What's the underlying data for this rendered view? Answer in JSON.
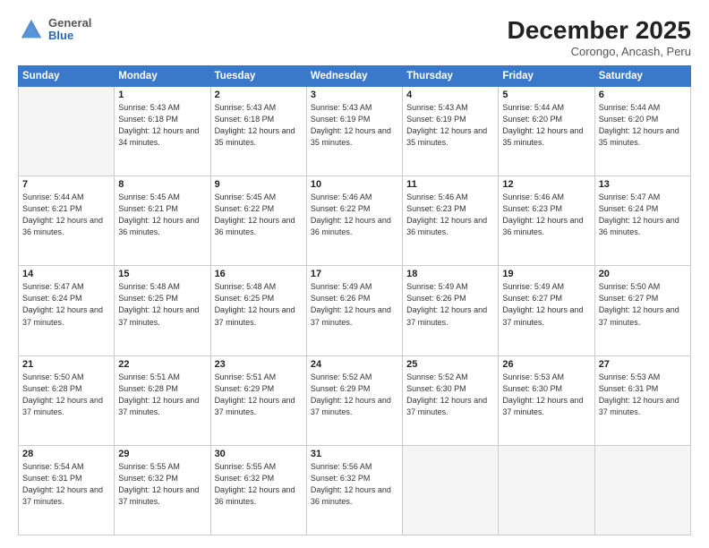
{
  "header": {
    "logo_general": "General",
    "logo_blue": "Blue",
    "title": "December 2025",
    "subtitle": "Corongo, Ancash, Peru"
  },
  "columns": [
    "Sunday",
    "Monday",
    "Tuesday",
    "Wednesday",
    "Thursday",
    "Friday",
    "Saturday"
  ],
  "weeks": [
    [
      {
        "day": "",
        "empty": true
      },
      {
        "day": "1",
        "sunrise": "Sunrise: 5:43 AM",
        "sunset": "Sunset: 6:18 PM",
        "daylight": "Daylight: 12 hours and 34 minutes."
      },
      {
        "day": "2",
        "sunrise": "Sunrise: 5:43 AM",
        "sunset": "Sunset: 6:18 PM",
        "daylight": "Daylight: 12 hours and 35 minutes."
      },
      {
        "day": "3",
        "sunrise": "Sunrise: 5:43 AM",
        "sunset": "Sunset: 6:19 PM",
        "daylight": "Daylight: 12 hours and 35 minutes."
      },
      {
        "day": "4",
        "sunrise": "Sunrise: 5:43 AM",
        "sunset": "Sunset: 6:19 PM",
        "daylight": "Daylight: 12 hours and 35 minutes."
      },
      {
        "day": "5",
        "sunrise": "Sunrise: 5:44 AM",
        "sunset": "Sunset: 6:20 PM",
        "daylight": "Daylight: 12 hours and 35 minutes."
      },
      {
        "day": "6",
        "sunrise": "Sunrise: 5:44 AM",
        "sunset": "Sunset: 6:20 PM",
        "daylight": "Daylight: 12 hours and 35 minutes."
      }
    ],
    [
      {
        "day": "7",
        "sunrise": "Sunrise: 5:44 AM",
        "sunset": "Sunset: 6:21 PM",
        "daylight": "Daylight: 12 hours and 36 minutes."
      },
      {
        "day": "8",
        "sunrise": "Sunrise: 5:45 AM",
        "sunset": "Sunset: 6:21 PM",
        "daylight": "Daylight: 12 hours and 36 minutes."
      },
      {
        "day": "9",
        "sunrise": "Sunrise: 5:45 AM",
        "sunset": "Sunset: 6:22 PM",
        "daylight": "Daylight: 12 hours and 36 minutes."
      },
      {
        "day": "10",
        "sunrise": "Sunrise: 5:46 AM",
        "sunset": "Sunset: 6:22 PM",
        "daylight": "Daylight: 12 hours and 36 minutes."
      },
      {
        "day": "11",
        "sunrise": "Sunrise: 5:46 AM",
        "sunset": "Sunset: 6:23 PM",
        "daylight": "Daylight: 12 hours and 36 minutes."
      },
      {
        "day": "12",
        "sunrise": "Sunrise: 5:46 AM",
        "sunset": "Sunset: 6:23 PM",
        "daylight": "Daylight: 12 hours and 36 minutes."
      },
      {
        "day": "13",
        "sunrise": "Sunrise: 5:47 AM",
        "sunset": "Sunset: 6:24 PM",
        "daylight": "Daylight: 12 hours and 36 minutes."
      }
    ],
    [
      {
        "day": "14",
        "sunrise": "Sunrise: 5:47 AM",
        "sunset": "Sunset: 6:24 PM",
        "daylight": "Daylight: 12 hours and 37 minutes."
      },
      {
        "day": "15",
        "sunrise": "Sunrise: 5:48 AM",
        "sunset": "Sunset: 6:25 PM",
        "daylight": "Daylight: 12 hours and 37 minutes."
      },
      {
        "day": "16",
        "sunrise": "Sunrise: 5:48 AM",
        "sunset": "Sunset: 6:25 PM",
        "daylight": "Daylight: 12 hours and 37 minutes."
      },
      {
        "day": "17",
        "sunrise": "Sunrise: 5:49 AM",
        "sunset": "Sunset: 6:26 PM",
        "daylight": "Daylight: 12 hours and 37 minutes."
      },
      {
        "day": "18",
        "sunrise": "Sunrise: 5:49 AM",
        "sunset": "Sunset: 6:26 PM",
        "daylight": "Daylight: 12 hours and 37 minutes."
      },
      {
        "day": "19",
        "sunrise": "Sunrise: 5:49 AM",
        "sunset": "Sunset: 6:27 PM",
        "daylight": "Daylight: 12 hours and 37 minutes."
      },
      {
        "day": "20",
        "sunrise": "Sunrise: 5:50 AM",
        "sunset": "Sunset: 6:27 PM",
        "daylight": "Daylight: 12 hours and 37 minutes."
      }
    ],
    [
      {
        "day": "21",
        "sunrise": "Sunrise: 5:50 AM",
        "sunset": "Sunset: 6:28 PM",
        "daylight": "Daylight: 12 hours and 37 minutes."
      },
      {
        "day": "22",
        "sunrise": "Sunrise: 5:51 AM",
        "sunset": "Sunset: 6:28 PM",
        "daylight": "Daylight: 12 hours and 37 minutes."
      },
      {
        "day": "23",
        "sunrise": "Sunrise: 5:51 AM",
        "sunset": "Sunset: 6:29 PM",
        "daylight": "Daylight: 12 hours and 37 minutes."
      },
      {
        "day": "24",
        "sunrise": "Sunrise: 5:52 AM",
        "sunset": "Sunset: 6:29 PM",
        "daylight": "Daylight: 12 hours and 37 minutes."
      },
      {
        "day": "25",
        "sunrise": "Sunrise: 5:52 AM",
        "sunset": "Sunset: 6:30 PM",
        "daylight": "Daylight: 12 hours and 37 minutes."
      },
      {
        "day": "26",
        "sunrise": "Sunrise: 5:53 AM",
        "sunset": "Sunset: 6:30 PM",
        "daylight": "Daylight: 12 hours and 37 minutes."
      },
      {
        "day": "27",
        "sunrise": "Sunrise: 5:53 AM",
        "sunset": "Sunset: 6:31 PM",
        "daylight": "Daylight: 12 hours and 37 minutes."
      }
    ],
    [
      {
        "day": "28",
        "sunrise": "Sunrise: 5:54 AM",
        "sunset": "Sunset: 6:31 PM",
        "daylight": "Daylight: 12 hours and 37 minutes."
      },
      {
        "day": "29",
        "sunrise": "Sunrise: 5:55 AM",
        "sunset": "Sunset: 6:32 PM",
        "daylight": "Daylight: 12 hours and 37 minutes."
      },
      {
        "day": "30",
        "sunrise": "Sunrise: 5:55 AM",
        "sunset": "Sunset: 6:32 PM",
        "daylight": "Daylight: 12 hours and 36 minutes."
      },
      {
        "day": "31",
        "sunrise": "Sunrise: 5:56 AM",
        "sunset": "Sunset: 6:32 PM",
        "daylight": "Daylight: 12 hours and 36 minutes."
      },
      {
        "day": "",
        "empty": true
      },
      {
        "day": "",
        "empty": true
      },
      {
        "day": "",
        "empty": true
      }
    ]
  ]
}
